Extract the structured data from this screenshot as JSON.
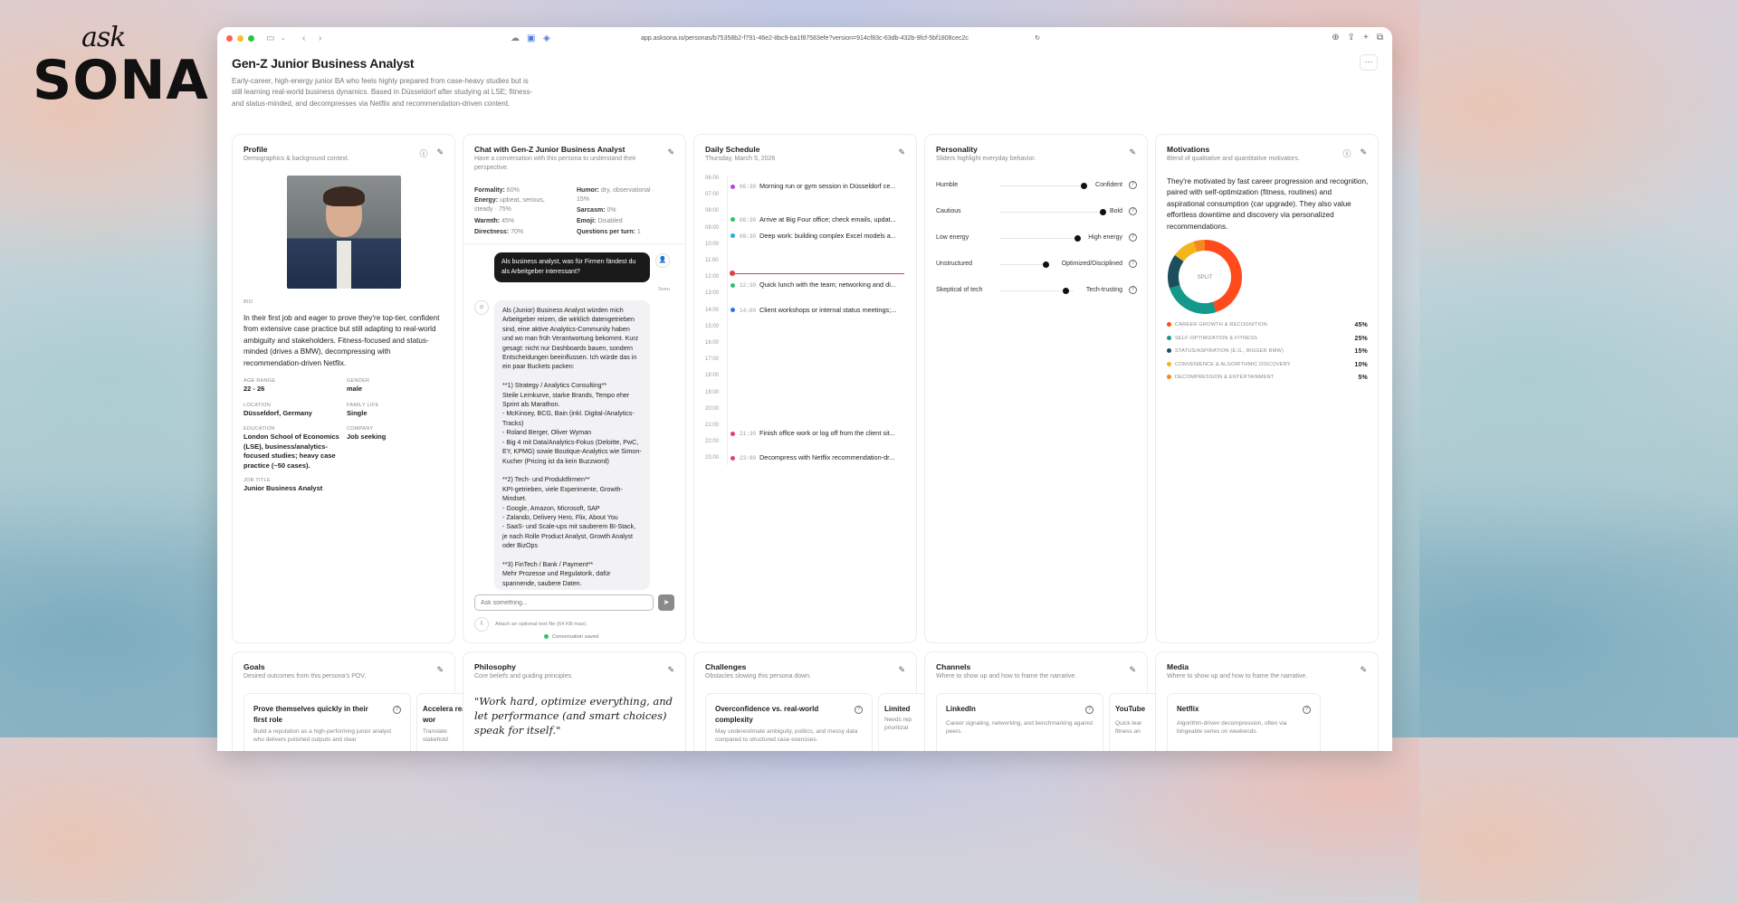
{
  "brand": {
    "ask": "ask",
    "sona": "SONA"
  },
  "browser": {
    "url": "app.asksona.io/personas/b75358b2-f791-46e2-8bc9-ba1f87583efe?version=914cf83c-63db-432b-9fcf-5bf1808cec2c"
  },
  "page": {
    "title": "Gen-Z Junior Business Analyst",
    "description": "Early-career, high-energy junior BA who feels highly prepared from case-heavy studies but is still learning real-world business dynamics. Based in Düsseldorf after studying at LSE; fitness- and status-minded, and decompresses via Netflix and recommendation-driven content.",
    "more_label": "···"
  },
  "profile": {
    "title": "Profile",
    "subtitle": "Demographics & background context.",
    "bio_label": "BIO",
    "bio": "In their first job and eager to prove they're top-tier, confident from extensive case practice but still adapting to real-world ambiguity and stakeholders. Fitness-focused and status-minded (drives a BMW), decompressing with recommendation-driven Netflix.",
    "age_label": "AGE RANGE",
    "age": "22 - 26",
    "gender_label": "GENDER",
    "gender": "male",
    "location_label": "LOCATION",
    "location": "Düsseldorf, Germany",
    "family_label": "FAMILY LIFE",
    "family": "Single",
    "education_label": "EDUCATION",
    "education": "London School of Economics (LSE), business/analytics-focused studies; heavy case practice (~50 cases).",
    "company_label": "COMPANY",
    "company": "Job seeking",
    "job_label": "JOB TITLE",
    "job": "Junior Business Analyst"
  },
  "chat": {
    "title": "Chat with Gen-Z Junior Business Analyst",
    "subtitle": "Have a conversation with this persona to understand their perspective.",
    "params": {
      "formality_label": "Formality:",
      "formality": "60%",
      "humor_label": "Humor:",
      "humor": "dry, observational · 15%",
      "energy_label": "Energy:",
      "energy": "upbeat, serious, steady · 75%",
      "sarcasm_label": "Sarcasm:",
      "sarcasm": "0%",
      "warmth_label": "Warmth:",
      "warmth": "45%",
      "emoji_label": "Emoji:",
      "emoji": "Disabled",
      "directness_label": "Directness:",
      "directness": "70%",
      "qpt_label": "Questions per turn:",
      "qpt": "1"
    },
    "user_message": "Als business analyst, was für Firmen fändest du als Arbeitgeber interessant?",
    "seen": "Seen",
    "bot_message": "Als (Junior) Business Analyst würden mich Arbeitgeber reizen, die wirklich datengetrieben sind, eine aktive Analytics-Community haben und wo man früh Verantwortung bekommt. Kurz gesagt: nicht nur Dashboards bauen, sondern Entscheidungen beeinflussen. Ich würde das in ein paar Buckets packen:\n\n**1) Strategy / Analytics Consulting**\nSteile Lernkurve, starke Brands, Tempo eher Sprint als Marathon.\n- McKinsey, BCG, Bain (inkl. Digital-/Analytics-Tracks)\n- Roland Berger, Oliver Wyman\n- Big 4 mit Data/Analytics-Fokus (Deloitte, PwC, EY, KPMG) sowie Boutique-Analytics wie Simon-Kucher (Pricing ist da kein Buzzword)\n\n**2) Tech- und Produktfirmen**\nKPI-getrieben, viele Experimente, Growth-Mindset.\n- Google, Amazon, Microsoft, SAP\n- Zalando, Delivery Hero, Flix, About You\n- SaaS- und Scale-ups mit sauberem BI-Stack, je nach Rolle Product Analyst, Growth Analyst oder BizOps\n\n**3) FinTech / Bank / Payment**\nMehr Prozesse und Regulatorik, dafür spannende, saubere Daten.",
    "input_placeholder": "Ask something...",
    "attach_text": "Attach an optional text file (64 KB max).",
    "saved_text": "Conversation saved"
  },
  "schedule": {
    "title": "Daily Schedule",
    "subtitle": "Thursday, March 5, 2026",
    "hours": [
      "06:00",
      "07:00",
      "08:00",
      "09:00",
      "10:00",
      "11:00",
      "12:00",
      "13:00",
      "14:00",
      "15:00",
      "16:00",
      "17:00",
      "18:00",
      "19:00",
      "20:00",
      "21:00",
      "22:00",
      "23:00"
    ],
    "events": [
      {
        "time": "06:30",
        "text": "Morning run or gym session in Düsseldorf ce...",
        "color": "#b04ad8"
      },
      {
        "time": "08:30",
        "text": "Arrive at Big Four office; check emails, updat...",
        "color": "#2fbf71"
      },
      {
        "time": "09:30",
        "text": "Deep work: building complex Excel models a...",
        "color": "#26b0d8"
      },
      {
        "time": "12:30",
        "text": "Quick lunch with the team; networking and di...",
        "color": "#2fbf71"
      },
      {
        "time": "14:00",
        "text": "Client workshops or internal status meetings;...",
        "color": "#3b6fe0"
      },
      {
        "time": "21:30",
        "text": "Finish office work or log off from the client sit...",
        "color": "#e0407a"
      },
      {
        "time": "23:00",
        "text": "Decompress with Netflix recommendation-dr...",
        "color": "#e0407a"
      }
    ]
  },
  "personality": {
    "title": "Personality",
    "subtitle": "Sliders highlight everyday behavior.",
    "traits": [
      {
        "left": "Humble",
        "right": "Confident",
        "value": 0.93
      },
      {
        "left": "Cautious",
        "right": "Bold",
        "value": 0.96
      },
      {
        "left": "Low energy",
        "right": "High energy",
        "value": 0.93
      },
      {
        "left": "Unstructured",
        "right": "Optimized/Disciplined",
        "value": 0.92
      },
      {
        "left": "Skeptical of tech",
        "right": "Tech-trusting",
        "value": 0.86
      }
    ]
  },
  "motivations": {
    "title": "Motivations",
    "subtitle": "Blend of qualitative and quantitative motivators.",
    "text": "They're motivated by fast career progression and recognition, paired with self-optimization (fitness, routines) and aspirational consumption (car upgrade). They also value effortless downtime and discovery via personalized recommendations.",
    "donut_label": "SPLIT",
    "items": [
      {
        "label": "CAREER GROWTH & RECOGNITION",
        "pct": "45%",
        "value": 45,
        "color": "#ff4a1c"
      },
      {
        "label": "SELF-OPTIMIZATION & FITNESS",
        "pct": "25%",
        "value": 25,
        "color": "#14988a"
      },
      {
        "label": "STATUS/ASPIRATION (E.G., BIGGER BMW)",
        "pct": "15%",
        "value": 15,
        "color": "#1c4e5e"
      },
      {
        "label": "CONVENIENCE & ALGORITHMIC DISCOVERY",
        "pct": "10%",
        "value": 10,
        "color": "#f5b41c"
      },
      {
        "label": "DECOMPRESSION & ENTERTAINMENT",
        "pct": "5%",
        "value": 5,
        "color": "#f58a1c"
      }
    ]
  },
  "goals": {
    "title": "Goals",
    "subtitle": "Desired outcomes from this persona's POV.",
    "items": [
      {
        "title": "Prove themselves quickly in their first role",
        "desc": "Build a reputation as a high-performing junior analyst who delivers polished outputs and clear"
      },
      {
        "title": "Accelera real wor",
        "desc": "Translate stakehold"
      }
    ]
  },
  "philosophy": {
    "title": "Philosophy",
    "subtitle": "Core beliefs and guiding principles.",
    "quote": "\"Work hard, optimize everything, and let performance (and smart choices) speak for itself.\""
  },
  "challenges": {
    "title": "Challenges",
    "subtitle": "Obstacles slowing this persona down.",
    "items": [
      {
        "title": "Overconfidence vs. real-world complexity",
        "desc": "May underestimate ambiguity, politics, and messy data compared to structured case exercises."
      },
      {
        "title": "Limited",
        "desc": "Needs rep prioritizat"
      }
    ]
  },
  "channels": {
    "title": "Channels",
    "subtitle": "Where to show up and how to frame the narrative.",
    "items": [
      {
        "title": "LinkedIn",
        "desc": "Career signaling, networking, and benchmarking against peers."
      },
      {
        "title": "YouTube",
        "desc": "Quick lear fitness an"
      }
    ]
  },
  "media": {
    "title": "Media",
    "subtitle": "Where to show up and how to frame the narrative.",
    "items": [
      {
        "title": "Netflix",
        "desc": "Algorithm-driven decompression, often via bingeable series on weekends."
      }
    ]
  }
}
